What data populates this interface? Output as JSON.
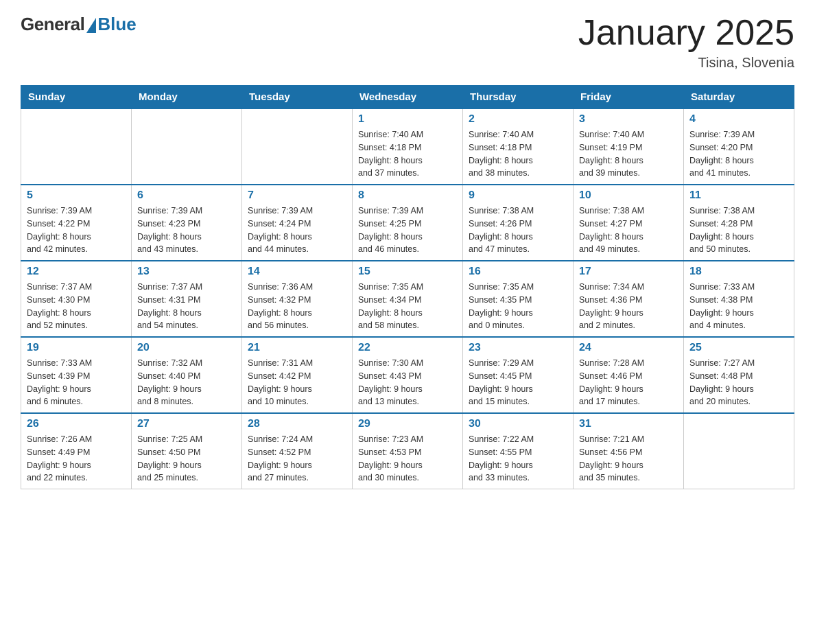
{
  "header": {
    "logo_general": "General",
    "logo_blue": "Blue",
    "title": "January 2025",
    "location": "Tisina, Slovenia"
  },
  "weekdays": [
    "Sunday",
    "Monday",
    "Tuesday",
    "Wednesday",
    "Thursday",
    "Friday",
    "Saturday"
  ],
  "weeks": [
    [
      {
        "num": "",
        "info": ""
      },
      {
        "num": "",
        "info": ""
      },
      {
        "num": "",
        "info": ""
      },
      {
        "num": "1",
        "info": "Sunrise: 7:40 AM\nSunset: 4:18 PM\nDaylight: 8 hours\nand 37 minutes."
      },
      {
        "num": "2",
        "info": "Sunrise: 7:40 AM\nSunset: 4:18 PM\nDaylight: 8 hours\nand 38 minutes."
      },
      {
        "num": "3",
        "info": "Sunrise: 7:40 AM\nSunset: 4:19 PM\nDaylight: 8 hours\nand 39 minutes."
      },
      {
        "num": "4",
        "info": "Sunrise: 7:39 AM\nSunset: 4:20 PM\nDaylight: 8 hours\nand 41 minutes."
      }
    ],
    [
      {
        "num": "5",
        "info": "Sunrise: 7:39 AM\nSunset: 4:22 PM\nDaylight: 8 hours\nand 42 minutes."
      },
      {
        "num": "6",
        "info": "Sunrise: 7:39 AM\nSunset: 4:23 PM\nDaylight: 8 hours\nand 43 minutes."
      },
      {
        "num": "7",
        "info": "Sunrise: 7:39 AM\nSunset: 4:24 PM\nDaylight: 8 hours\nand 44 minutes."
      },
      {
        "num": "8",
        "info": "Sunrise: 7:39 AM\nSunset: 4:25 PM\nDaylight: 8 hours\nand 46 minutes."
      },
      {
        "num": "9",
        "info": "Sunrise: 7:38 AM\nSunset: 4:26 PM\nDaylight: 8 hours\nand 47 minutes."
      },
      {
        "num": "10",
        "info": "Sunrise: 7:38 AM\nSunset: 4:27 PM\nDaylight: 8 hours\nand 49 minutes."
      },
      {
        "num": "11",
        "info": "Sunrise: 7:38 AM\nSunset: 4:28 PM\nDaylight: 8 hours\nand 50 minutes."
      }
    ],
    [
      {
        "num": "12",
        "info": "Sunrise: 7:37 AM\nSunset: 4:30 PM\nDaylight: 8 hours\nand 52 minutes."
      },
      {
        "num": "13",
        "info": "Sunrise: 7:37 AM\nSunset: 4:31 PM\nDaylight: 8 hours\nand 54 minutes."
      },
      {
        "num": "14",
        "info": "Sunrise: 7:36 AM\nSunset: 4:32 PM\nDaylight: 8 hours\nand 56 minutes."
      },
      {
        "num": "15",
        "info": "Sunrise: 7:35 AM\nSunset: 4:34 PM\nDaylight: 8 hours\nand 58 minutes."
      },
      {
        "num": "16",
        "info": "Sunrise: 7:35 AM\nSunset: 4:35 PM\nDaylight: 9 hours\nand 0 minutes."
      },
      {
        "num": "17",
        "info": "Sunrise: 7:34 AM\nSunset: 4:36 PM\nDaylight: 9 hours\nand 2 minutes."
      },
      {
        "num": "18",
        "info": "Sunrise: 7:33 AM\nSunset: 4:38 PM\nDaylight: 9 hours\nand 4 minutes."
      }
    ],
    [
      {
        "num": "19",
        "info": "Sunrise: 7:33 AM\nSunset: 4:39 PM\nDaylight: 9 hours\nand 6 minutes."
      },
      {
        "num": "20",
        "info": "Sunrise: 7:32 AM\nSunset: 4:40 PM\nDaylight: 9 hours\nand 8 minutes."
      },
      {
        "num": "21",
        "info": "Sunrise: 7:31 AM\nSunset: 4:42 PM\nDaylight: 9 hours\nand 10 minutes."
      },
      {
        "num": "22",
        "info": "Sunrise: 7:30 AM\nSunset: 4:43 PM\nDaylight: 9 hours\nand 13 minutes."
      },
      {
        "num": "23",
        "info": "Sunrise: 7:29 AM\nSunset: 4:45 PM\nDaylight: 9 hours\nand 15 minutes."
      },
      {
        "num": "24",
        "info": "Sunrise: 7:28 AM\nSunset: 4:46 PM\nDaylight: 9 hours\nand 17 minutes."
      },
      {
        "num": "25",
        "info": "Sunrise: 7:27 AM\nSunset: 4:48 PM\nDaylight: 9 hours\nand 20 minutes."
      }
    ],
    [
      {
        "num": "26",
        "info": "Sunrise: 7:26 AM\nSunset: 4:49 PM\nDaylight: 9 hours\nand 22 minutes."
      },
      {
        "num": "27",
        "info": "Sunrise: 7:25 AM\nSunset: 4:50 PM\nDaylight: 9 hours\nand 25 minutes."
      },
      {
        "num": "28",
        "info": "Sunrise: 7:24 AM\nSunset: 4:52 PM\nDaylight: 9 hours\nand 27 minutes."
      },
      {
        "num": "29",
        "info": "Sunrise: 7:23 AM\nSunset: 4:53 PM\nDaylight: 9 hours\nand 30 minutes."
      },
      {
        "num": "30",
        "info": "Sunrise: 7:22 AM\nSunset: 4:55 PM\nDaylight: 9 hours\nand 33 minutes."
      },
      {
        "num": "31",
        "info": "Sunrise: 7:21 AM\nSunset: 4:56 PM\nDaylight: 9 hours\nand 35 minutes."
      },
      {
        "num": "",
        "info": ""
      }
    ]
  ]
}
